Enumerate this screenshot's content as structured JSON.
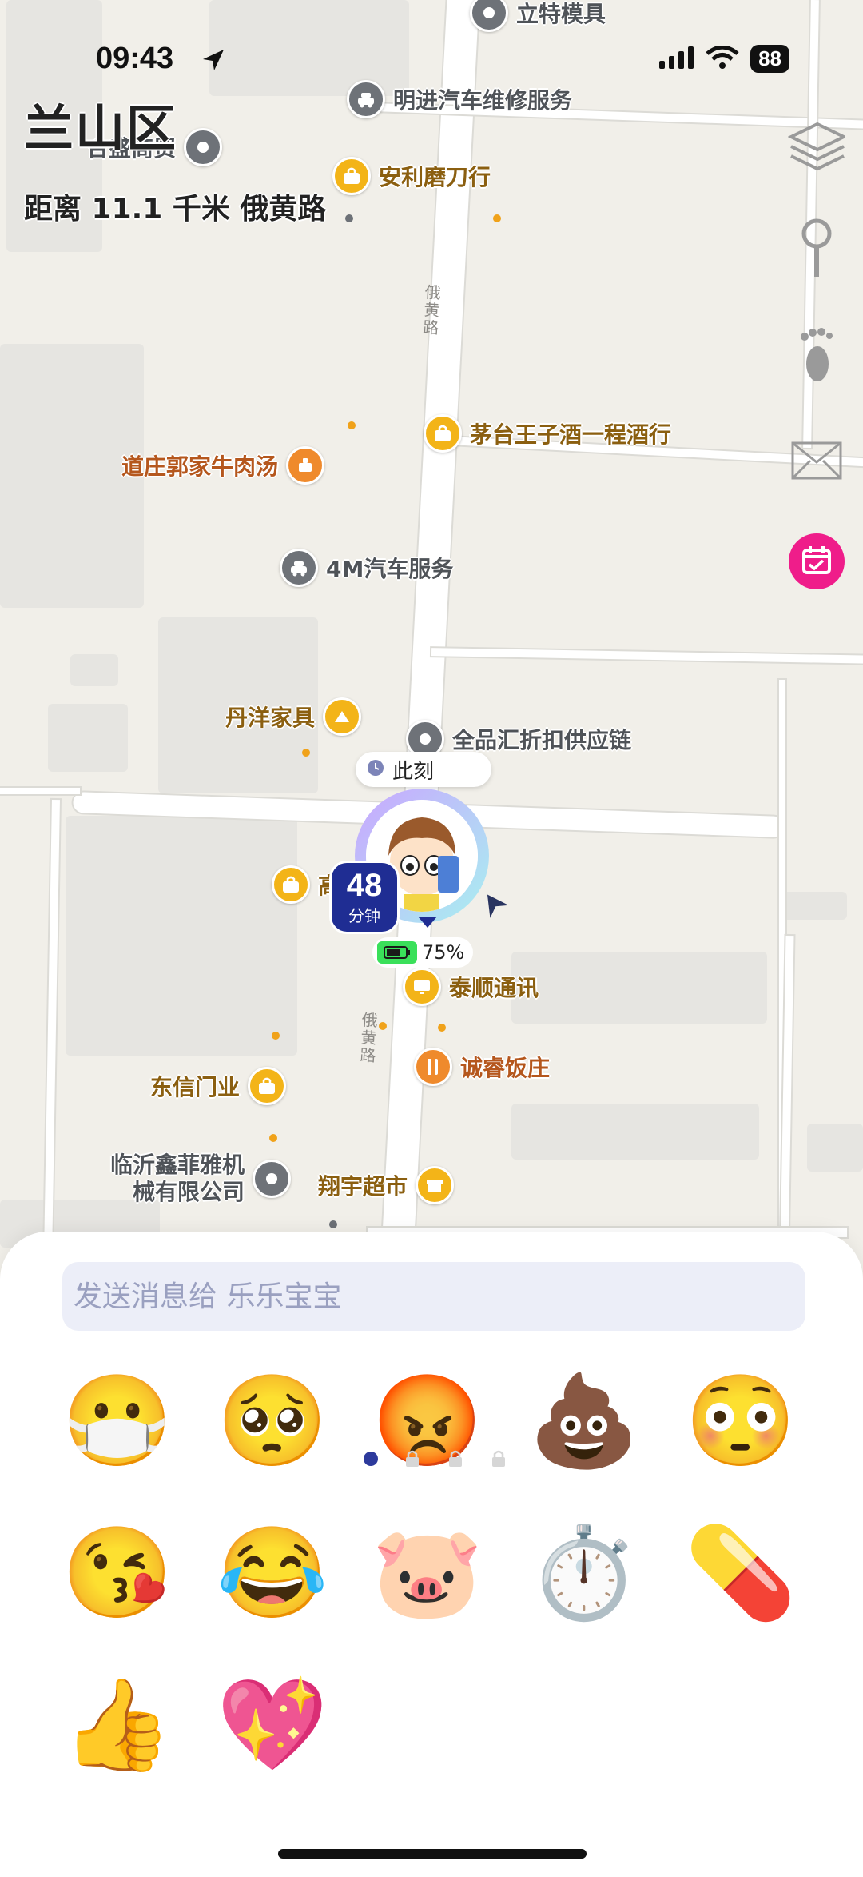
{
  "status_bar": {
    "time": "09:43",
    "battery": "88"
  },
  "header": {
    "district": "兰山区",
    "distance_text": "距离 11.1 千米 俄黄路"
  },
  "map": {
    "road_labels": [
      "俄黄路",
      "俄黄路"
    ],
    "pois": [
      {
        "name": "立特模具",
        "icon": "pin-icon"
      },
      {
        "name": "明进汽车维修服务",
        "icon": "car-service-icon"
      },
      {
        "name": "合盛商贸",
        "icon": "pin-icon"
      },
      {
        "name": "安利磨刀行",
        "icon": "shopping-bag-icon"
      },
      {
        "name": "茅台王子酒一程酒行",
        "icon": "shopping-bag-icon"
      },
      {
        "name": "道庄郭家牛肉汤",
        "icon": "food-icon"
      },
      {
        "name": "4M汽车服务",
        "icon": "car-service-icon"
      },
      {
        "name": "丹洋家具",
        "icon": "furniture-icon"
      },
      {
        "name": "全品汇折扣供应链",
        "icon": "pin-icon"
      },
      {
        "name": "泰顺通讯",
        "icon": "electronics-icon"
      },
      {
        "name": "诚睿饭庄",
        "icon": "restaurant-icon"
      },
      {
        "name": "东信门业",
        "icon": "shopping-bag-icon"
      },
      {
        "name": "临沂鑫菲雅机械有限公司",
        "icon": "pin-icon"
      },
      {
        "name": "翔宇超市",
        "icon": "supermarket-icon"
      },
      {
        "name": "高",
        "icon": "shopping-bag-icon"
      }
    ],
    "user_marker": {
      "now_label": "此刻",
      "eta_value": "48",
      "eta_unit": "分钟",
      "battery_percent": "75%"
    },
    "side_buttons": [
      "layers-icon",
      "pin-drop-icon",
      "footprint-icon",
      "mail-icon",
      "calendar-icon"
    ]
  },
  "sheet": {
    "message_placeholder": "发送消息给 乐乐宝宝",
    "emojis": [
      "😷",
      "🥺",
      "😡",
      "💩",
      "😳",
      "😘",
      "😂",
      "🐷",
      "⏱️",
      "💊",
      "👍",
      "💖"
    ],
    "page_count": 4,
    "current_page": 1
  }
}
